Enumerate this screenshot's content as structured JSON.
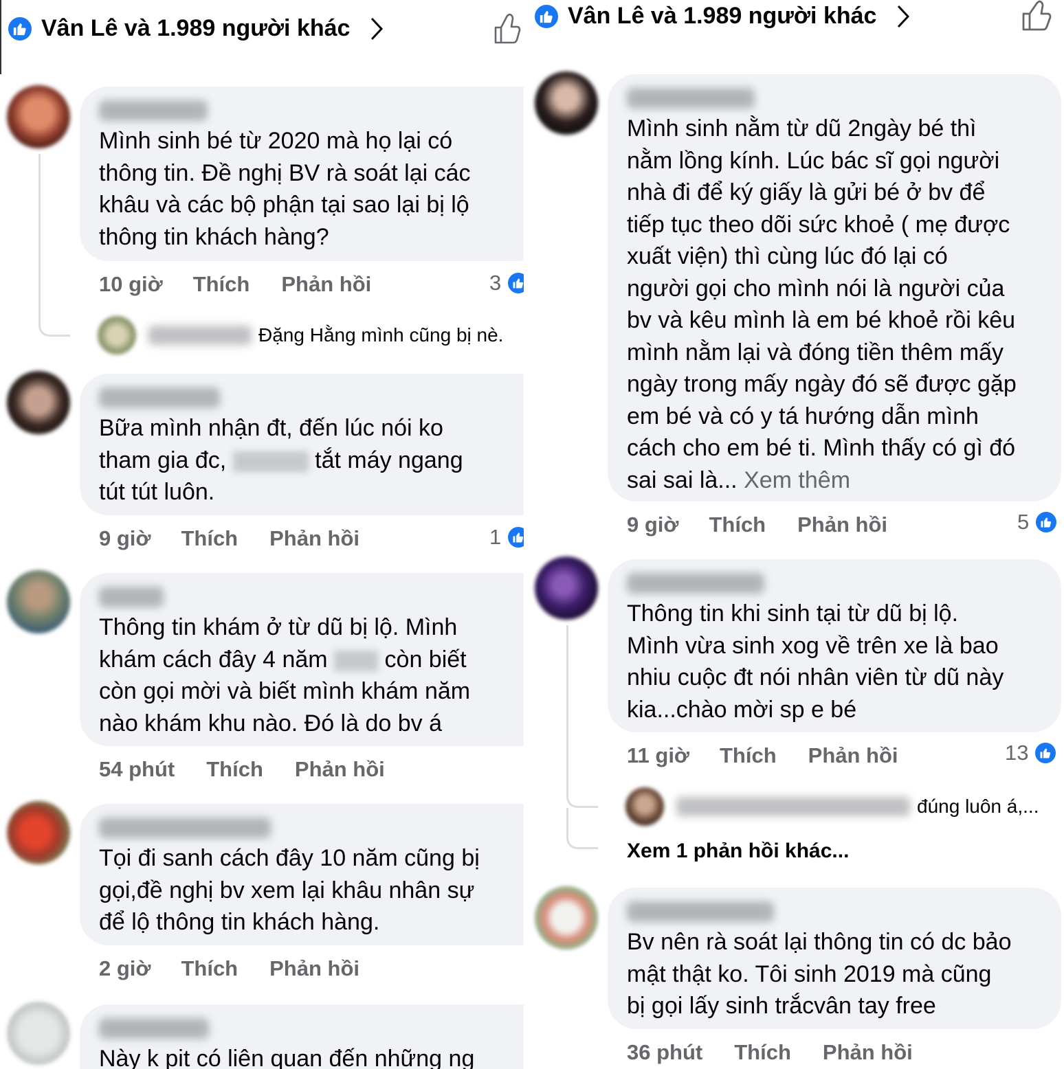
{
  "reactions": {
    "summary": "Vân Lê và 1.989 người khác"
  },
  "colors": {
    "facebook_blue": "#1877f2",
    "bubble": "#f0f2f5",
    "meta_text": "#65676b"
  },
  "icons": {
    "like": "like-badge-icon",
    "chevron": "chevron-right-icon",
    "thumb": "thumbs-up-outline-icon"
  },
  "left": {
    "comments": [
      {
        "lines": [
          "Mình sinh bé từ 2020 mà họ lại có",
          "thông tin. Đề nghị BV rà soát lại các",
          "khâu và các bộ phận tại sao lại bị lộ",
          "thông tin khách hàng?"
        ],
        "time": "10 giờ",
        "like": "Thích",
        "reply": "Phản hồi",
        "reactions": "3",
        "reply_preview": {
          "text": "Đặng Hằng mình cũng bị nè."
        }
      },
      {
        "lines_pre": "Bữa mình nhận đt, đến lúc nói ko",
        "line2_start": "tham gia đc,",
        "line2_end": "tắt máy ngang",
        "line3": "tút tút luôn.",
        "time": "9 giờ",
        "like": "Thích",
        "reply": "Phản hồi",
        "reactions": "1"
      },
      {
        "line1": "Thông tin khám ở từ dũ bị lộ. Mình",
        "line2_start": "khám cách đây 4 năm",
        "line2_end": "còn biết",
        "line3": "còn gọi mời và biết mình khám năm",
        "line4": "nào khám khu nào. Đó là do bv á",
        "time": "54 phút",
        "like": "Thích",
        "reply": "Phản hồi"
      },
      {
        "lines": [
          "Tọi đi sanh cách đây 10 năm cũng bị",
          "gọi,đề nghị bv xem lại khâu nhân sự",
          "để lộ thông tin khách hàng."
        ],
        "time": "2 giờ",
        "like": "Thích",
        "reply": "Phản hồi"
      },
      {
        "lines": [
          "Này k pit có liên quan đến những ng"
        ]
      }
    ]
  },
  "right": {
    "comments": [
      {
        "lines": [
          "Mình sinh nằm từ dũ 2ngày bé thì",
          "nằm lồng kính. Lúc bác sĩ gọi người",
          "nhà đi để ký giấy là gửi bé ở bv để",
          "tiếp tục theo dõi sức khoẻ ( mẹ được",
          "xuất viện)  thì cùng lúc đó lại có",
          "người gọi cho mình nói là người của",
          "bv và kêu mình là em bé khoẻ rồi kêu",
          "mình nằm lại và đóng tiền thêm mấy",
          "ngày trong mấy ngày đó sẽ được gặp",
          "em bé và có y tá hướng dẫn mình",
          "cách cho em bé ti. Mình thấy có gì đó"
        ],
        "last_line": "sai sai là...",
        "see_more": "Xem thêm",
        "time": "9 giờ",
        "like": "Thích",
        "reply": "Phản hồi",
        "reactions": "5"
      },
      {
        "lines": [
          "Thông tin khi sinh tại từ dũ bị lộ.",
          "Mình vừa sinh xog về trên xe là bao",
          "nhiu cuộc đt nói nhân viên từ dũ này",
          "kia...chào mời sp e bé"
        ],
        "time": "11 giờ",
        "like": "Thích",
        "reply": "Phản hồi",
        "reactions": "13",
        "reply_preview": {
          "text": "đúng luôn á,..."
        },
        "more_replies": "Xem 1 phản hồi khác..."
      },
      {
        "lines": [
          "Bv nên rà soát lại thông tin có dc bảo",
          "mật thật ko. Tôi sinh 2019 mà cũng",
          "bị gọi lấy sinh trắcvân tay free"
        ],
        "time": "36 phút",
        "like": "Thích",
        "reply": "Phản hồi"
      }
    ]
  }
}
